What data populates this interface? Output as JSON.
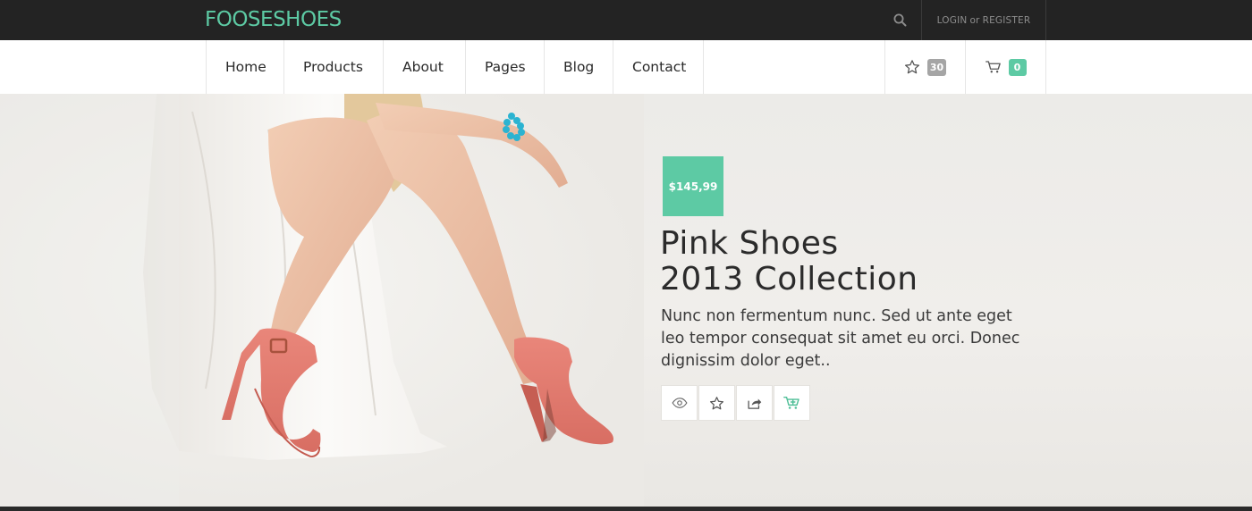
{
  "header": {
    "logo": "FOOSESHOES",
    "search_icon": "search-icon",
    "login_label": "LOGIN",
    "or_label": "or",
    "register_label": "REGISTER"
  },
  "nav": {
    "items": [
      {
        "label": "Home"
      },
      {
        "label": "Products"
      },
      {
        "label": "About"
      },
      {
        "label": "Pages"
      },
      {
        "label": "Blog"
      },
      {
        "label": "Contact"
      }
    ],
    "wishlist_count": "30",
    "cart_count": "0"
  },
  "hero": {
    "price": "$145,99",
    "title_line1": "Pink Shoes",
    "title_line2": "2013 Collection",
    "description": "Nunc non fermentum nunc. Sed ut ante eget leo tempor consequat sit amet eu orci. Donec dignissim dolor eget..",
    "actions": [
      "eye-icon",
      "star-icon",
      "share-icon",
      "add-to-cart-icon"
    ]
  },
  "colors": {
    "accent": "#5dcaa4",
    "topbar": "#232323",
    "badge_grey": "#a5a5a5"
  }
}
